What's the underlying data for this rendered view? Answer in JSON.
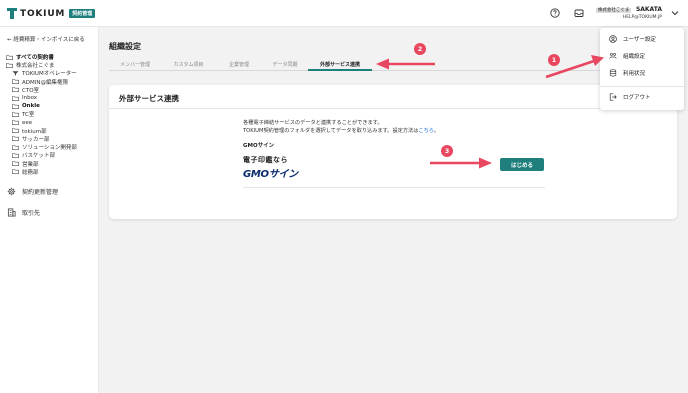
{
  "header": {
    "logo_text": "TOKIUM",
    "logo_badge": "契約管理",
    "company_badge": "株式会社こぐま",
    "user_name": "SAKATA",
    "user_email": "HELP@TOKIUM.JP",
    "icons": [
      "help-circle-icon",
      "inbox-icon",
      "chevron-down-icon"
    ]
  },
  "sidebar": {
    "back_link": "← 経費精算・インボイスに戻る",
    "tree": [
      {
        "label": "すべての契約書",
        "icon": "folder-icon",
        "bold": true
      },
      {
        "label": "株式会社こぐま",
        "icon": "folder-icon",
        "bold": false
      },
      {
        "label": "TOKIUMオペレーター",
        "icon": "filter-icon",
        "bold": false
      },
      {
        "label": "ADMIN@編集権限",
        "icon": "folder-icon",
        "bold": false
      },
      {
        "label": "CTO室",
        "icon": "folder-icon",
        "bold": false
      },
      {
        "label": "Inbox",
        "icon": "folder-icon",
        "bold": false
      },
      {
        "label": "Onkle",
        "icon": "folder-icon",
        "bold": true
      },
      {
        "label": "TC室",
        "icon": "folder-icon",
        "bold": false
      },
      {
        "label": "eee",
        "icon": "folder-icon",
        "bold": false
      },
      {
        "label": "tokium部",
        "icon": "folder-icon",
        "bold": false
      },
      {
        "label": "サッカー部",
        "icon": "folder-icon",
        "bold": false
      },
      {
        "label": "ソリューション開発部",
        "icon": "folder-icon",
        "bold": false
      },
      {
        "label": "バスケット部",
        "icon": "folder-icon",
        "bold": false
      },
      {
        "label": "営業部",
        "icon": "folder-icon",
        "bold": false
      },
      {
        "label": "総務部",
        "icon": "folder-icon",
        "bold": false
      }
    ],
    "nav": {
      "renewal": "契約更新管理",
      "partners": "取引先"
    }
  },
  "main": {
    "title": "組織設定",
    "tabs": [
      {
        "label": "メンバー管理",
        "active": false
      },
      {
        "label": "カスタム項目",
        "active": false
      },
      {
        "label": "企業管理",
        "active": false
      },
      {
        "label": "データ同期",
        "active": false
      },
      {
        "label": "外部サービス連携",
        "active": true
      }
    ],
    "card": {
      "title": "外部サービス連携",
      "desc_line1": "各種電子締結サービスのデータと連携することができます。",
      "desc_line2": "TOKIUM契約管理のフォルダを選択してデータを取り込みます。設定方法は",
      "desc_link": "こちら",
      "desc_end": "。",
      "service_label": "GMOサイン",
      "logo_line1": "電子印鑑なら",
      "logo_line2": "GMOサイン",
      "start_button": "はじめる"
    }
  },
  "dropdown": {
    "items": [
      {
        "label": "ユーザー設定",
        "icon": "user-circle-icon"
      },
      {
        "label": "組織設定",
        "icon": "organization-gear-icon"
      },
      {
        "label": "利用状況",
        "icon": "database-icon"
      },
      {
        "label": "ログアウト",
        "icon": "logout-icon"
      }
    ]
  },
  "annotations": {
    "steps": [
      "1",
      "2",
      "3"
    ],
    "color": "#e8475f"
  },
  "colors": {
    "brand": "#1e7f7d",
    "annotation": "#e8475f",
    "link": "#1a73e8"
  }
}
